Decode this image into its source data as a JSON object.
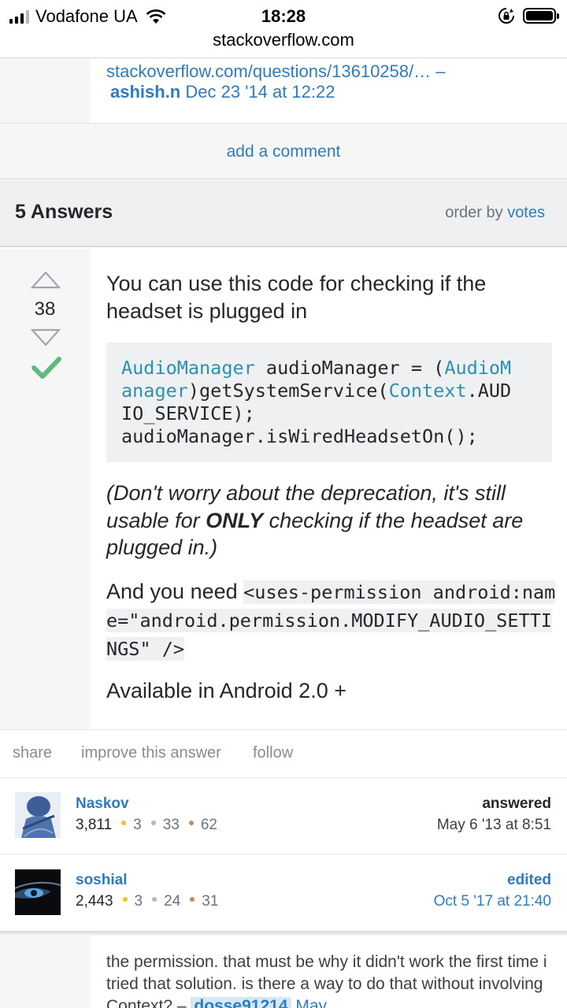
{
  "status_bar": {
    "carrier": "Vodafone UA",
    "time": "18:28",
    "url": "stackoverflow.com"
  },
  "prev_comment": {
    "link": "stackoverflow.com/questions/13610258/… –",
    "author": "ashish.n",
    "date": "Dec 23 '14 at 12:22"
  },
  "add_comment_label": "add a comment",
  "answers_header": {
    "count": "5 Answers",
    "order_by_label": "order by",
    "order_by_value": "votes"
  },
  "answer": {
    "votes": "38",
    "p1": "You can use this code for checking if the headset is plugged in",
    "code": {
      "t1": "AudioManager",
      "t2": " audioManager = (",
      "t3": "AudioM",
      "t4": "anager",
      "t5": ")getSystemService(",
      "t6": "Context",
      "t7": ".AUD",
      "t8": "IO_SERVICE);",
      "t9": "audioManager.isWiredHeadsetOn();"
    },
    "p2_a": "(Don't worry about the deprecation, it's still usable for ",
    "p2_bold": "ONLY",
    "p2_b": " checking if the headset are plugged in.)",
    "p3_a": "And you need ",
    "p3_code": "<uses-permission android:name=\"android.permission.MODIFY_AUDIO_SETTINGS\" />",
    "p4": "Available in Android 2.0 +"
  },
  "actions": {
    "share": "share",
    "improve": "improve this answer",
    "follow": "follow"
  },
  "answered_by": {
    "name": "Naskov",
    "rep": "3,811",
    "gold": "3",
    "silver": "33",
    "bronze": "62",
    "label": "answered",
    "date": "May 6 '13 at 8:51"
  },
  "edited_by": {
    "name": "soshial",
    "rep": "2,443",
    "gold": "3",
    "silver": "24",
    "bronze": "31",
    "label": "edited",
    "date": "Oct 5 '17 at 21:40"
  },
  "bottom_comment": {
    "text": "the permission. that must be why it didn't work the first time i tried that solution. is there a way to do that without involving Context? –",
    "user": "dosse91214",
    "date": "May"
  },
  "colors": {
    "link": "#2f7bbf",
    "accepted": "#5eba7d",
    "code_type": "#2b91af",
    "gold": "#f1c40f",
    "silver": "#b4b8bc",
    "bronze": "#c38b5f"
  }
}
